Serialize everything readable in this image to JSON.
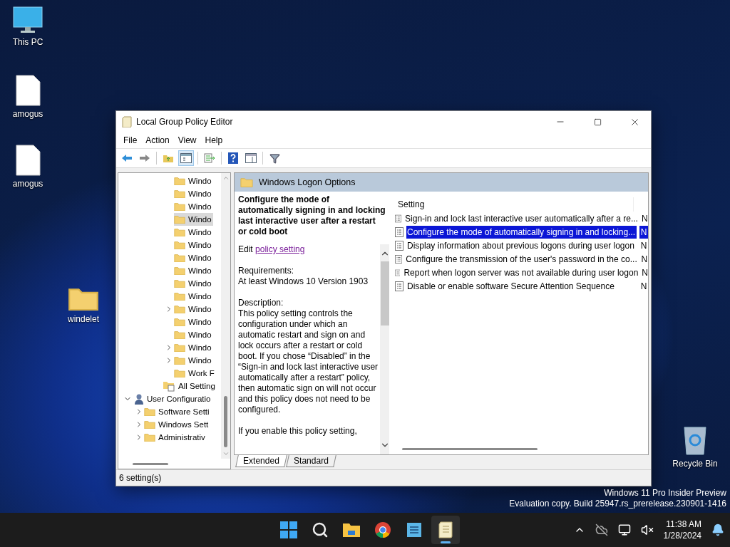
{
  "desktop_icons": [
    {
      "kind": "pc",
      "label": "This PC"
    },
    {
      "kind": "file",
      "label": "amogus"
    },
    {
      "kind": "file",
      "label": "amogus"
    },
    {
      "kind": "folder",
      "label": "windelet"
    },
    {
      "kind": "bin",
      "label": "Recycle Bin"
    }
  ],
  "window": {
    "title": "Local Group Policy Editor"
  },
  "menu": [
    "File",
    "Action",
    "View",
    "Help"
  ],
  "toolbar": [
    {
      "kind": "back",
      "selected": false
    },
    {
      "kind": "forward",
      "selected": false
    },
    {
      "kind": "up",
      "selected": false
    },
    {
      "kind": "tree",
      "selected": true
    },
    {
      "kind": "export",
      "selected": false
    },
    {
      "kind": "help",
      "selected": false
    },
    {
      "kind": "panel",
      "selected": false
    },
    {
      "kind": "filter",
      "selected": false
    }
  ],
  "tree": [
    {
      "kind": "folder",
      "label": "Windo",
      "expandable": false,
      "selected": false
    },
    {
      "kind": "folder",
      "label": "Windo",
      "expandable": false,
      "selected": false
    },
    {
      "kind": "folder",
      "label": "Windo",
      "expandable": false,
      "selected": false
    },
    {
      "kind": "folder",
      "label": "Windo",
      "expandable": false,
      "selected": true
    },
    {
      "kind": "folder",
      "label": "Windo",
      "expandable": false,
      "selected": false
    },
    {
      "kind": "folder",
      "label": "Windo",
      "expandable": false,
      "selected": false
    },
    {
      "kind": "folder",
      "label": "Windo",
      "expandable": false,
      "selected": false
    },
    {
      "kind": "folder",
      "label": "Windo",
      "expandable": false,
      "selected": false
    },
    {
      "kind": "folder",
      "label": "Windo",
      "expandable": false,
      "selected": false
    },
    {
      "kind": "folder",
      "label": "Windo",
      "expandable": false,
      "selected": false
    },
    {
      "kind": "folder",
      "label": "Windo",
      "expandable": true,
      "expanded": false,
      "selected": false
    },
    {
      "kind": "folder",
      "label": "Windo",
      "expandable": false,
      "selected": false
    },
    {
      "kind": "folder",
      "label": "Windo",
      "expandable": false,
      "selected": false
    },
    {
      "kind": "folder",
      "label": "Windo",
      "expandable": true,
      "expanded": false,
      "selected": false
    },
    {
      "kind": "folder",
      "label": "Windo",
      "expandable": true,
      "expanded": false,
      "selected": false
    },
    {
      "kind": "folder",
      "label": "Work F",
      "expandable": false,
      "selected": false
    },
    {
      "kind": "all-settings",
      "label": "All Setting",
      "expandable": false,
      "selected": false
    },
    {
      "kind": "user",
      "label": "User Configuratio",
      "expandable": true,
      "expanded": true,
      "selected": false,
      "children": [
        {
          "kind": "folder",
          "label": "Software Setti",
          "expandable": true,
          "expanded": false,
          "selected": false
        },
        {
          "kind": "folder",
          "label": "Windows Sett",
          "expandable": true,
          "expanded": false,
          "selected": false
        },
        {
          "kind": "folder",
          "label": "Administrativ",
          "expandable": true,
          "expanded": false,
          "selected": false
        }
      ]
    }
  ],
  "header": "Windows Logon Options",
  "extended": {
    "title": "Configure the mode of automatically signing in and locking last interactive user after a restart or cold boot",
    "edit_prefix": "Edit",
    "edit_link": "policy setting",
    "requirements_label": "Requirements:",
    "requirements": "At least Windows 10 Version 1903",
    "description_label": "Description:",
    "description": "This policy setting controls the configuration under which an automatic restart and sign on and lock occurs after a restart or cold boot. If you chose “Disabled” in the “Sign-in and lock last interactive user automatically after a restart” policy, then automatic sign on will not occur and this policy does not need to be configured.",
    "description_more": "If you enable this policy setting,"
  },
  "settings": {
    "column": "Setting",
    "rows": [
      {
        "name": "Sign-in and lock last interactive user automatically after a re...",
        "state": "N",
        "selected": false
      },
      {
        "name": "Configure the mode of automatically signing in and locking...",
        "state": "N",
        "selected": true
      },
      {
        "name": "Display information about previous logons during user logon",
        "state": "N",
        "selected": false
      },
      {
        "name": "Configure the transmission of the user's password in the co...",
        "state": "N",
        "selected": false
      },
      {
        "name": "Report when logon server was not available during user logon",
        "state": "N",
        "selected": false
      },
      {
        "name": "Disable or enable software Secure Attention Sequence",
        "state": "N",
        "selected": false
      }
    ]
  },
  "view_tabs": [
    {
      "label": "Extended",
      "selected": true
    },
    {
      "label": "Standard",
      "selected": false
    }
  ],
  "status_bar": "6 setting(s)",
  "watermark_lines": [
    "Windows 11 Pro Insider Preview",
    "Evaluation copy. Build 25947.rs_prerelease.230901-1416"
  ],
  "taskbar": {
    "apps": [
      {
        "kind": "start",
        "selected": false
      },
      {
        "kind": "search",
        "selected": false
      },
      {
        "kind": "explorer",
        "selected": false
      },
      {
        "kind": "browser",
        "selected": false
      },
      {
        "kind": "notepad",
        "selected": false
      },
      {
        "kind": "policy",
        "selected": true
      }
    ],
    "time": "11:38 AM",
    "date": "1/28/2024"
  }
}
